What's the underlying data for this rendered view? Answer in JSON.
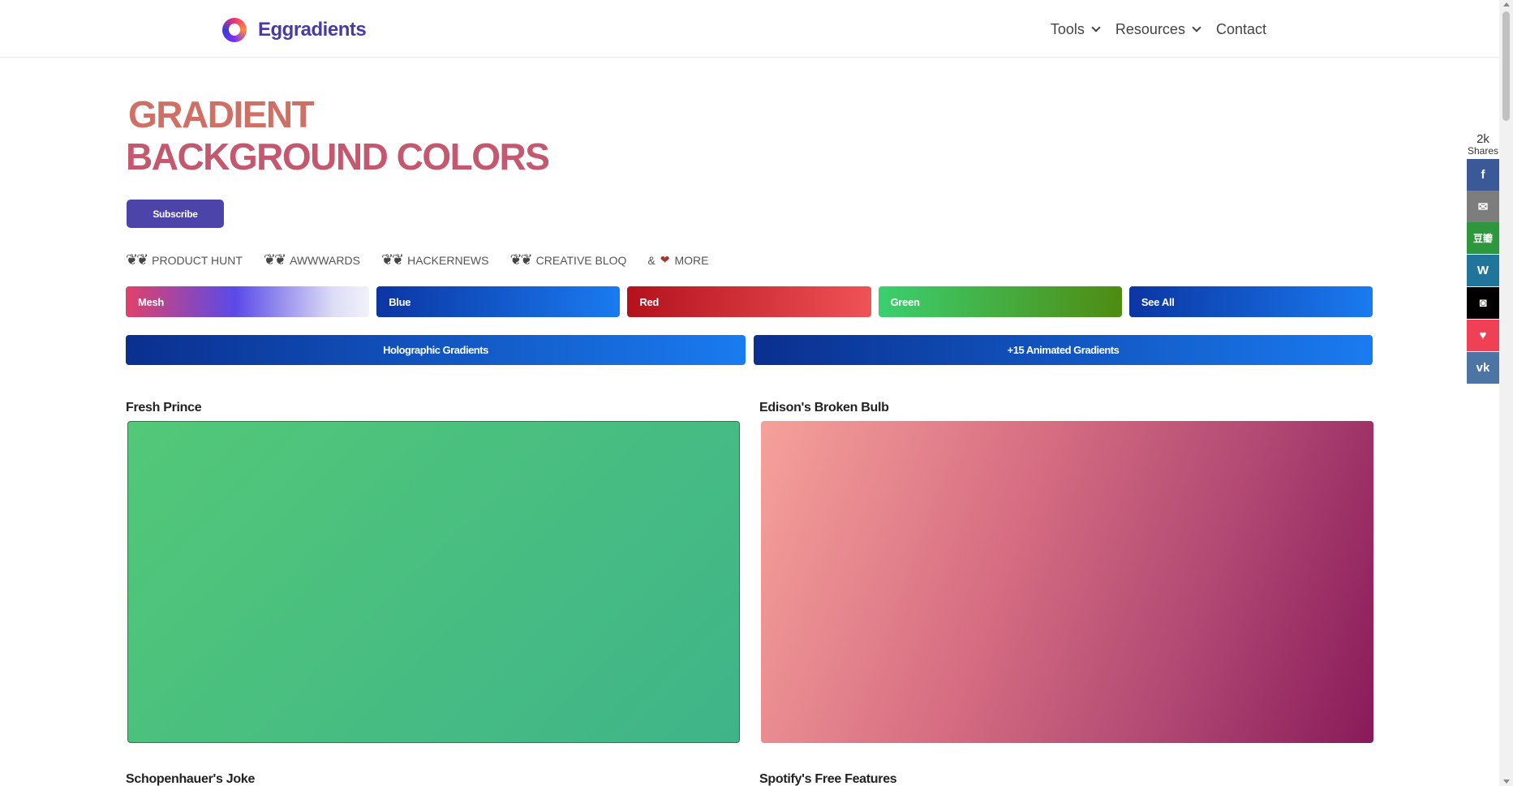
{
  "header": {
    "logo_text": "Eggradients",
    "nav": [
      {
        "label": "Tools",
        "has_dropdown": true
      },
      {
        "label": "Resources",
        "has_dropdown": true
      },
      {
        "label": "Contact",
        "has_dropdown": false
      }
    ]
  },
  "hero": {
    "title_line1": "GRADIENT",
    "title_line2": "BACKGROUND COLORS",
    "subscribe_label": "Subscribe"
  },
  "awards": {
    "items": [
      "PRODUCT HUNT",
      "AWWWARDS",
      "HACKERNEWS",
      "CREATIVE BLOQ"
    ],
    "amp": "&",
    "more": "MORE"
  },
  "categories": [
    "Mesh",
    "Blue",
    "Red",
    "Green",
    "See All"
  ],
  "wide_buttons": {
    "holographic": "Holographic Gradients",
    "animated": "+15 Animated Gradients"
  },
  "gradients": [
    {
      "name": "Fresh Prince",
      "colors": [
        "#52c878",
        "#3fb489"
      ]
    },
    {
      "name": "Edison's Broken Bulb",
      "colors": [
        "#f6a19a",
        "#891a5a"
      ]
    },
    {
      "name": "Schopenhauer's Joke"
    },
    {
      "name": "Spotify's Free Features"
    }
  ],
  "share": {
    "count": "2k",
    "label": "Shares",
    "buttons": [
      {
        "name": "facebook",
        "glyph": "f",
        "color": "#3b5998"
      },
      {
        "name": "email",
        "glyph": "✉",
        "color": "#7d7d7d"
      },
      {
        "name": "douban",
        "glyph": "豆瓣",
        "color": "#2e963d"
      },
      {
        "name": "wordpress",
        "glyph": "W",
        "color": "#21759b"
      },
      {
        "name": "blogger-like",
        "glyph": "◙",
        "color": "#000000"
      },
      {
        "name": "pocket",
        "glyph": "♥",
        "color": "#ef4056"
      },
      {
        "name": "vk",
        "glyph": "vk",
        "color": "#4c75a3"
      }
    ]
  }
}
